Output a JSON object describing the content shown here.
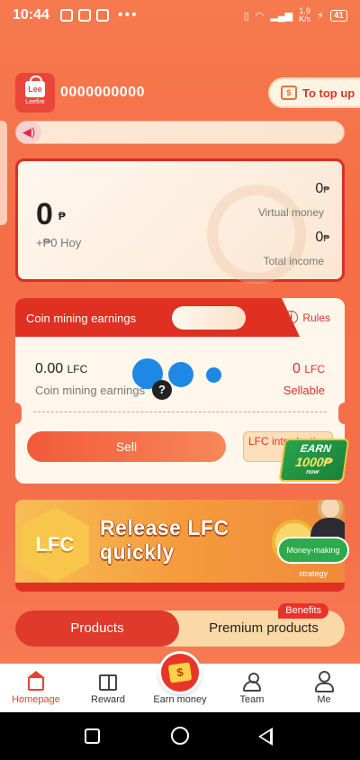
{
  "status_bar": {
    "time": "10:44",
    "dots": "•••",
    "net_speed_top": "1.9",
    "net_speed_bottom": "K/s",
    "battery": "41"
  },
  "header": {
    "logo_text": "Lee",
    "logo_name": "Leefire",
    "account_number": "0000000000",
    "topup_label": "To top up",
    "topup_icon": "$"
  },
  "balance": {
    "amount": "0",
    "currency": "₱",
    "today": "+₱0 Hoy",
    "virtual_money_value": "0",
    "virtual_money_label": "Virtual money",
    "total_income_value": "0",
    "total_income_label": "Total income"
  },
  "mining": {
    "title": "Coin mining earnings",
    "rules_label": "Rules",
    "earnings_value": "0.00",
    "earnings_unit": "LFC",
    "earnings_label": "Coin mining earnings",
    "sellable_value": "0",
    "sellable_unit": "LFC",
    "sellable_label": "Sellable",
    "sell_button": "Sell",
    "lfc_intro_button": "LFC introduction",
    "help_mark": "?"
  },
  "earn_badge": {
    "line1": "EARN",
    "line2": "1000₱",
    "line3": "now"
  },
  "banner": {
    "coin_text": "LFC",
    "title_line1": "Release LFC",
    "title_line2": "quickly",
    "strategy_label": "Money-making strategy"
  },
  "products": {
    "tab_products": "Products",
    "tab_premium": "Premium products",
    "benefits_badge": "Benefits"
  },
  "bottom_nav": {
    "homepage": "Homepage",
    "reward": "Reward",
    "earn_money": "Earn money",
    "team": "Team",
    "me": "Me"
  },
  "colors": {
    "accent_red": "#df3022",
    "background_orange": "#f5704a",
    "active_nav": "#e6442f"
  }
}
